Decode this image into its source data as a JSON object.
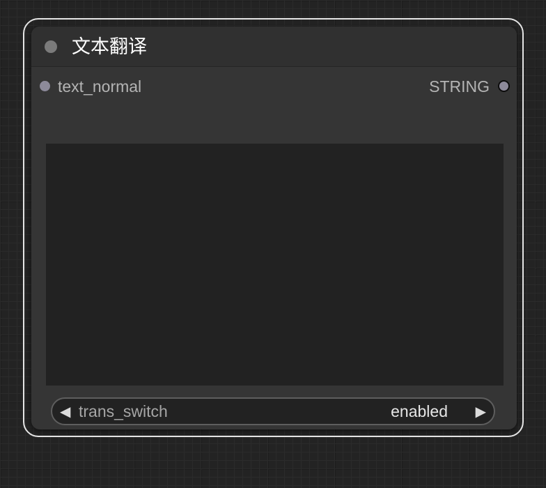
{
  "node": {
    "title": "文本翻译",
    "input": {
      "label": "text_normal"
    },
    "output": {
      "label": "STRING"
    },
    "textarea": {
      "value": ""
    },
    "combo": {
      "label": "trans_switch",
      "value": "enabled",
      "left_arrow": "◀",
      "right_arrow": "▶"
    }
  },
  "colors": {
    "canvas_background": "#232323",
    "node_body": "#353535",
    "node_header": "#303030",
    "selection_outline": "#e6e6e6",
    "slot_dot": "#8d8a9a",
    "widget_background": "#222222"
  }
}
